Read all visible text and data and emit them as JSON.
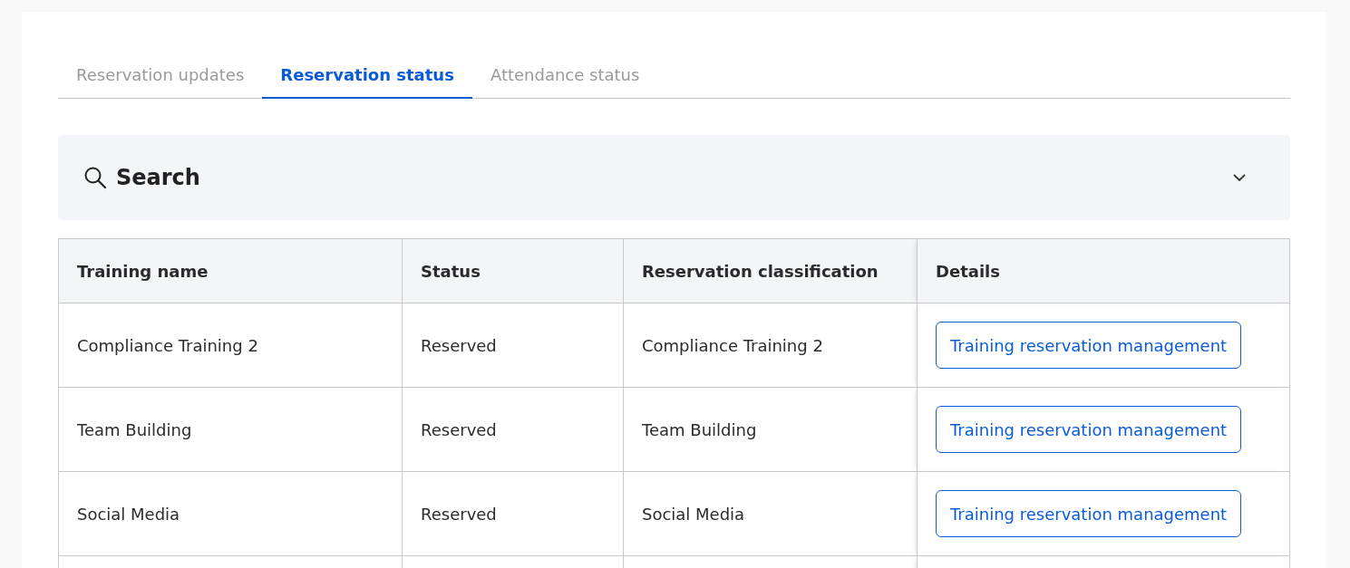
{
  "tabs": [
    {
      "label": "Reservation updates",
      "selected": false
    },
    {
      "label": "Reservation status",
      "selected": true
    },
    {
      "label": "Attendance status",
      "selected": false
    }
  ],
  "search": {
    "title": "Search",
    "expanded": false
  },
  "table": {
    "columns": [
      "Training name",
      "Status",
      "Reservation classification",
      "Details"
    ],
    "rows": [
      {
        "training_name": "Compliance Training 2",
        "status": "Reserved",
        "classification": "Compliance Training 2",
        "action": "Training reservation management"
      },
      {
        "training_name": "Team Building",
        "status": "Reserved",
        "classification": "Team Building",
        "action": "Training reservation management"
      },
      {
        "training_name": "Social Media",
        "status": "Reserved",
        "classification": "Social Media",
        "action": "Training reservation management"
      }
    ]
  }
}
